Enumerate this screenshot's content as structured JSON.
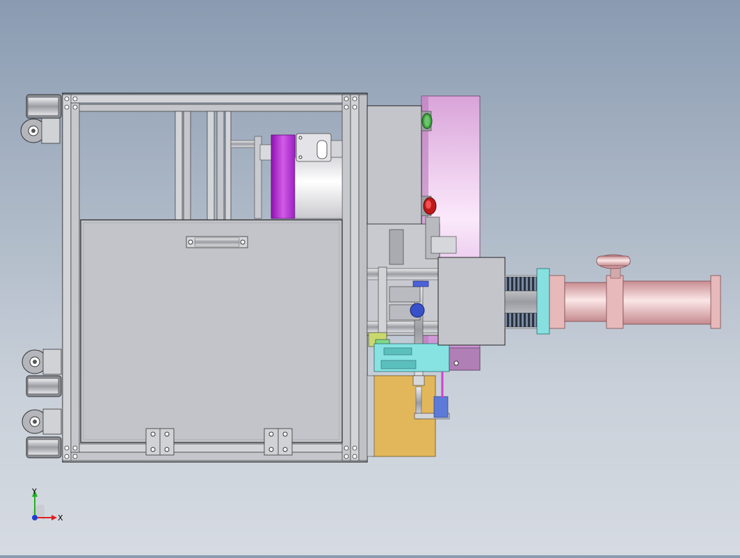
{
  "viewport": {
    "background_top": "#8a9bb1",
    "background_bottom": "#d6dbe2"
  },
  "triad": {
    "x_label": "X",
    "y_label": "Y",
    "x_color": "#e02020",
    "y_color": "#20b020",
    "z_color": "#1f3fd0"
  },
  "colors": {
    "frame": "#c9ccd2",
    "frame_dark": "#6b6f76",
    "panel": "#c2c3c8",
    "magenta": "#b82ad8",
    "pink_wheel": "#e8b6ec",
    "yellow": "#e3b85a",
    "teal": "#7fe3e0",
    "salmon": "#e8b9bb",
    "spring": "#2c3440"
  }
}
